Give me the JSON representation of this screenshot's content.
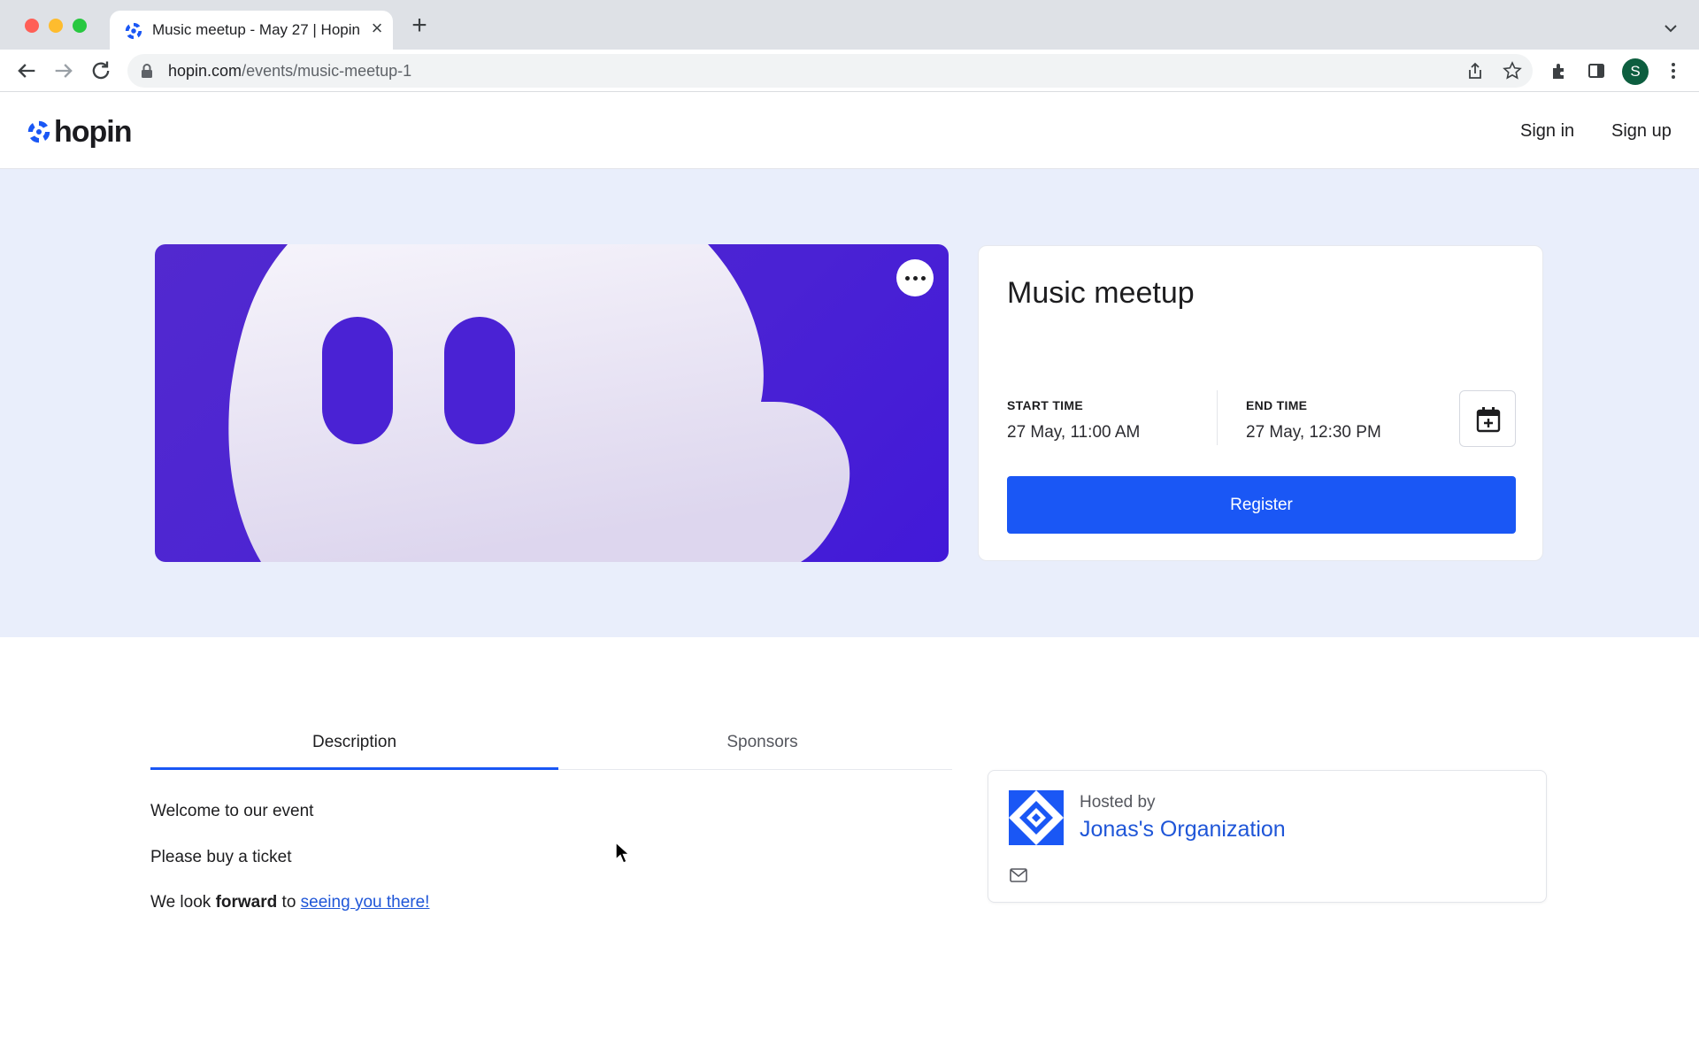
{
  "browser": {
    "tab_title": "Music meetup - May 27 | Hopin",
    "url_domain": "hopin.com",
    "url_path": "/events/music-meetup-1",
    "profile_initial": "S"
  },
  "header": {
    "logo_text": "hopin",
    "sign_in": "Sign in",
    "sign_up": "Sign up"
  },
  "event": {
    "title": "Music meetup",
    "start_label": "START TIME",
    "start_value": "27 May, 11:00 AM",
    "end_label": "END TIME",
    "end_value": "27 May, 12:30 PM",
    "register_label": "Register"
  },
  "tabs": [
    {
      "label": "Description",
      "active": true
    },
    {
      "label": "Sponsors",
      "active": false
    }
  ],
  "description": {
    "line1": "Welcome to our event",
    "line2": "Please buy a ticket",
    "line3_before": "We look ",
    "line3_bold": "forward",
    "line3_middle": " to ",
    "line3_link": "seeing you there!"
  },
  "host": {
    "hosted_by_label": "Hosted by",
    "name": "Jonas's Organization"
  },
  "colors": {
    "accent": "#1a57f5",
    "hero_bg": "#e9eefb",
    "banner_purple": "#4a22d4",
    "link": "#1f56d8"
  }
}
